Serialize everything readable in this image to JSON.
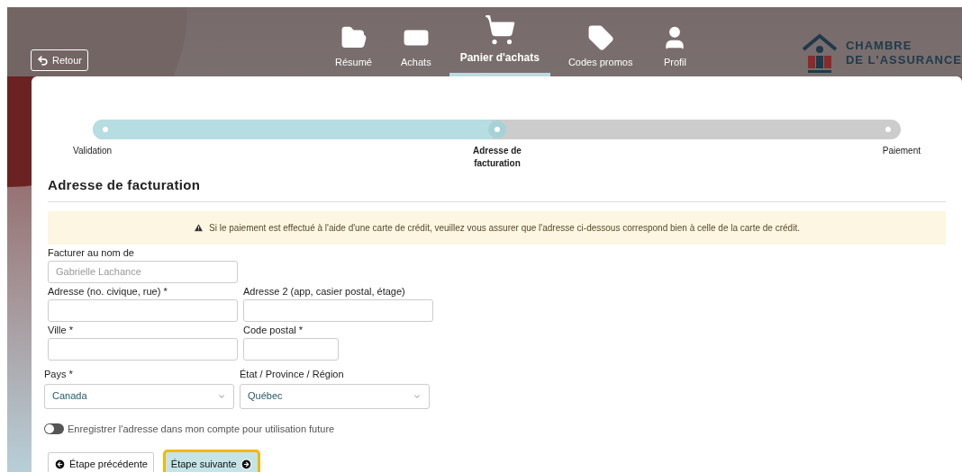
{
  "back_button": {
    "label": "Retour"
  },
  "nav": [
    {
      "label": "Résumé",
      "selected": false
    },
    {
      "label": "Achats",
      "selected": false
    },
    {
      "label": "Panier d'achats",
      "selected": true
    },
    {
      "label": "Codes promos",
      "selected": false
    },
    {
      "label": "Profil",
      "selected": false
    }
  ],
  "logo": {
    "line_1": "CHAMBRE",
    "line_2": "DE L'ASSURANCE"
  },
  "stepper": {
    "level": 0.5,
    "steps": [
      {
        "label": "Validation",
        "selected": false
      },
      {
        "label": "Adresse de facturation",
        "selected": true
      },
      {
        "label": "Paiement",
        "selected": false
      }
    ]
  },
  "heading": "Adresse de facturation",
  "warning": "Si le paiement est effectué à l'aide d'une carte de crédit, veuillez vous assurer que l'adresse ci-dessous correspond bien à celle de la carte de crédit.",
  "fields": [
    {
      "kind": "text",
      "label": "Facturer au nom de",
      "placeholder": "Gabrielle Lachance"
    },
    {
      "kind": "text",
      "label": "Adresse (no. civique, rue) *"
    },
    {
      "kind": "text",
      "label": "Adresse 2 (app, casier postal, étage)"
    },
    {
      "kind": "text",
      "label": "Ville *"
    },
    {
      "kind": "text",
      "label": "Code postal *"
    },
    {
      "kind": "select",
      "label": "Pays *",
      "value": "Canada"
    },
    {
      "kind": "select",
      "label": "État / Province / Région",
      "value": "Québec"
    }
  ],
  "save_toggle": {
    "label": "Enregistrer l'adresse dans mon compte pour utilisation future",
    "on": false
  },
  "buttons": [
    {
      "kind": "previous",
      "label": "Étape précédente",
      "highlighted": false
    },
    {
      "kind": "next",
      "label": "Étape suivante",
      "highlighted": true
    }
  ]
}
